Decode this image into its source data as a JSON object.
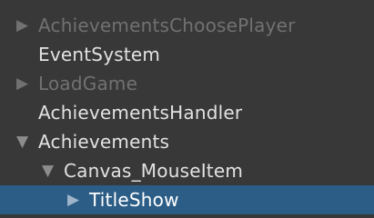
{
  "hierarchy": {
    "items": [
      {
        "label": "AchievementsChoosePlayer",
        "arrow": "▶"
      },
      {
        "label": "EventSystem",
        "arrow": ""
      },
      {
        "label": "LoadGame",
        "arrow": "▶"
      },
      {
        "label": "AchievementsHandler",
        "arrow": ""
      },
      {
        "label": "Achievements",
        "arrow": "▼"
      },
      {
        "label": "Canvas_MouseItem",
        "arrow": "▼"
      },
      {
        "label": "TitleShow",
        "arrow": "▶"
      }
    ],
    "colors": {
      "background": "#383838",
      "selection": "#2c5d87",
      "active_text": "#e2e2e2",
      "inactive_text": "#717171"
    }
  }
}
